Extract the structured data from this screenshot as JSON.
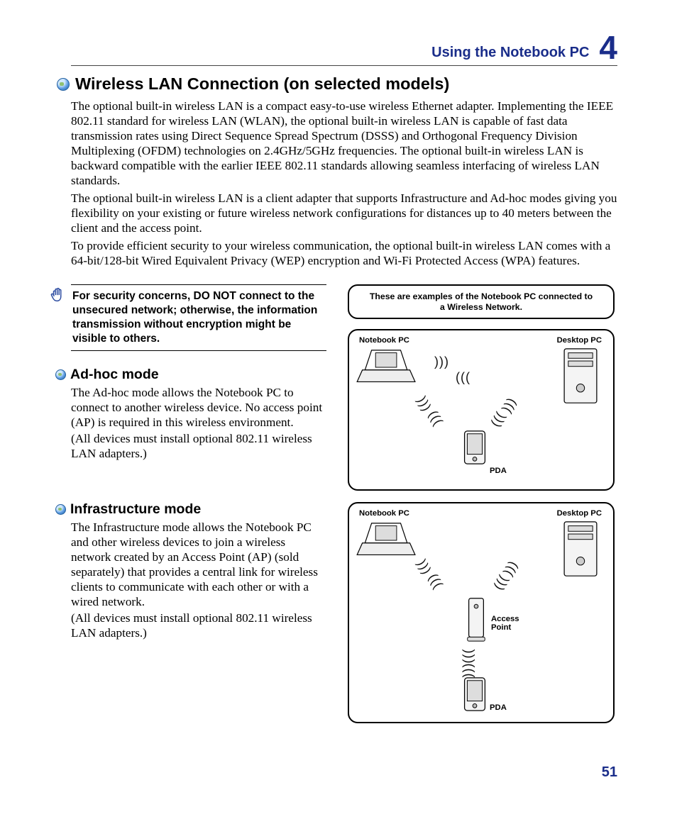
{
  "header": {
    "section_title": "Using the Notebook PC",
    "chapter_number": "4"
  },
  "main_heading": "Wireless LAN Connection (on selected models)",
  "intro_paragraphs": [
    "The optional built-in wireless LAN is a compact easy-to-use wireless Ethernet adapter. Implementing the IEEE 802.11 standard for wireless LAN (WLAN), the optional built-in wireless LAN is capable of fast data transmission rates using Direct Sequence Spread Spectrum (DSSS) and Orthogonal Frequency Division Multiplexing (OFDM) technologies on 2.4GHz/5GHz frequencies. The optional built-in wireless LAN is backward compatible with the earlier IEEE 802.11 standards allowing seamless interfacing of wireless LAN standards.",
    "The optional built-in wireless LAN is a client adapter that supports Infrastructure and Ad-hoc modes giving you flexibility on your existing or future wireless network configurations for distances up to 40 meters between the client and the access point.",
    "To provide efficient security to your wireless communication, the optional built-in wireless LAN comes with a 64-bit/128-bit Wired Equivalent Privacy (WEP) encryption and Wi-Fi Protected Access (WPA) features."
  ],
  "warning": "For security concerns, DO NOT connect to the unsecured network; otherwise, the information transmission without encryption might be visible to others.",
  "sections": {
    "adhoc": {
      "title": "Ad-hoc mode",
      "body": [
        "The Ad-hoc mode allows the Notebook PC to connect to another wireless device. No access point (AP) is required in this wireless environment.",
        "(All devices must install optional 802.11 wireless LAN adapters.)"
      ]
    },
    "infra": {
      "title": "Infrastructure mode",
      "body": [
        "The Infrastructure mode allows the Notebook PC and other wireless devices to join a wireless network created by an Access Point (AP) (sold separately) that provides a central link for wireless clients to communicate with each other or with a wired network.",
        "(All devices must install optional 802.11 wireless LAN adapters.)"
      ]
    }
  },
  "diagrams": {
    "caption": "These are examples of the Notebook PC connected to a Wireless Network.",
    "labels": {
      "notebook": "Notebook PC",
      "desktop": "Desktop PC",
      "pda": "PDA",
      "access_point": "Access Point"
    }
  },
  "page_number": "51"
}
